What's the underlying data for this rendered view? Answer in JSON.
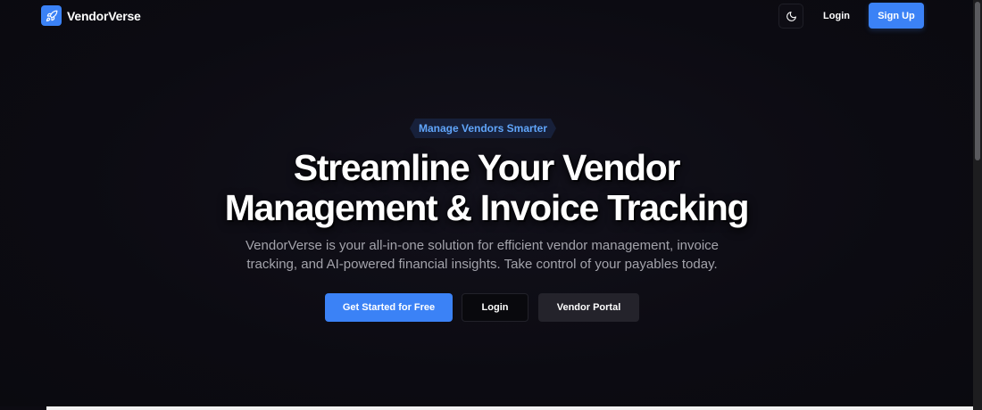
{
  "header": {
    "brand_name": "VendorVerse",
    "logo_icon": "rocket-icon",
    "theme_icon": "moon-icon",
    "login_label": "Login",
    "signup_label": "Sign Up"
  },
  "hero": {
    "badge": "Manage Vendors Smarter",
    "title_line1": "Streamline Your Vendor",
    "title_line2": "Management & Invoice Tracking",
    "subtitle": "VendorVerse is your all-in-one solution for efficient vendor management, invoice tracking, and AI-powered financial insights. Take control of your payables today.",
    "cta_primary": "Get Started for Free",
    "cta_login": "Login",
    "cta_vendor_portal": "Vendor Portal"
  },
  "colors": {
    "background": "#0c0b12",
    "accent": "#3b82f6",
    "badge_text": "#60a5fa",
    "muted_text": "#a3a3ab"
  }
}
